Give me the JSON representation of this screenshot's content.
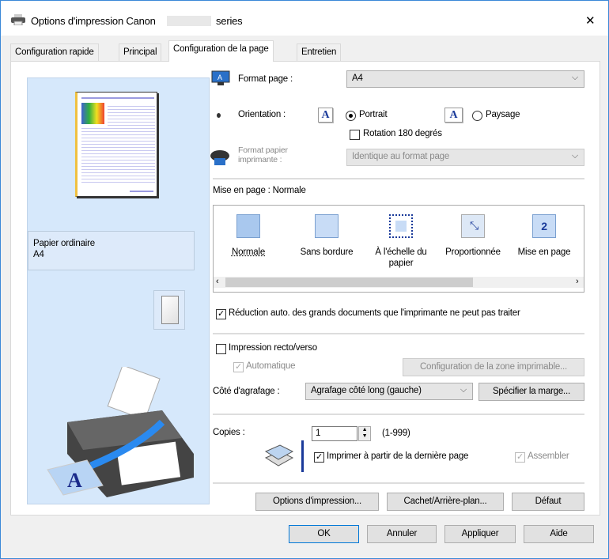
{
  "window": {
    "title_prefix": "Options d'impression Canon",
    "title_suffix": "series",
    "close": "✕"
  },
  "tabs": [
    "Configuration rapide",
    "Principal",
    "Configuration de la page",
    "Entretien"
  ],
  "preview": {
    "paper_type": "Papier ordinaire",
    "paper_size": "A4"
  },
  "page_size": {
    "label": "Format page :",
    "value": "A4"
  },
  "orientation": {
    "label": "Orientation :",
    "portrait": "Portrait",
    "landscape": "Paysage",
    "selected": "Portrait",
    "icon_letter": "A",
    "rotate_label": "Rotation 180 degrés",
    "rotate_checked": false
  },
  "printer_paper": {
    "label_line1": "Format papier",
    "label_line2": "imprimante :",
    "value": "Identique au format page"
  },
  "layout": {
    "label": "Mise en page : Normale",
    "items": [
      "Normale",
      "Sans bordure",
      "À l'échelle du papier",
      "Proportionnée",
      "Mise en page"
    ],
    "selected": "Normale",
    "icon_number": "2"
  },
  "auto_reduce": {
    "label": "Réduction auto. des grands documents que l'imprimante ne peut pas traiter",
    "checked": true
  },
  "duplex": {
    "label": "Impression recto/verso",
    "checked": false,
    "auto_label": "Automatique",
    "auto_checked": true,
    "print_area_button": "Configuration de la zone imprimable..."
  },
  "stapling": {
    "label": "Côté d'agrafage :",
    "value": "Agrafage côté long (gauche)",
    "margin_button": "Spécifier la marge..."
  },
  "copies": {
    "label": "Copies :",
    "value": "1",
    "range": "(1-999)",
    "reverse_label": "Imprimer à partir de la dernière page",
    "reverse_checked": true,
    "collate_label": "Assembler",
    "collate_checked": true
  },
  "buttons": {
    "print_options": "Options d'impression...",
    "stamp": "Cachet/Arrière-plan...",
    "defaults": "Défaut",
    "ok": "OK",
    "cancel": "Annuler",
    "apply": "Appliquer",
    "help": "Aide"
  }
}
